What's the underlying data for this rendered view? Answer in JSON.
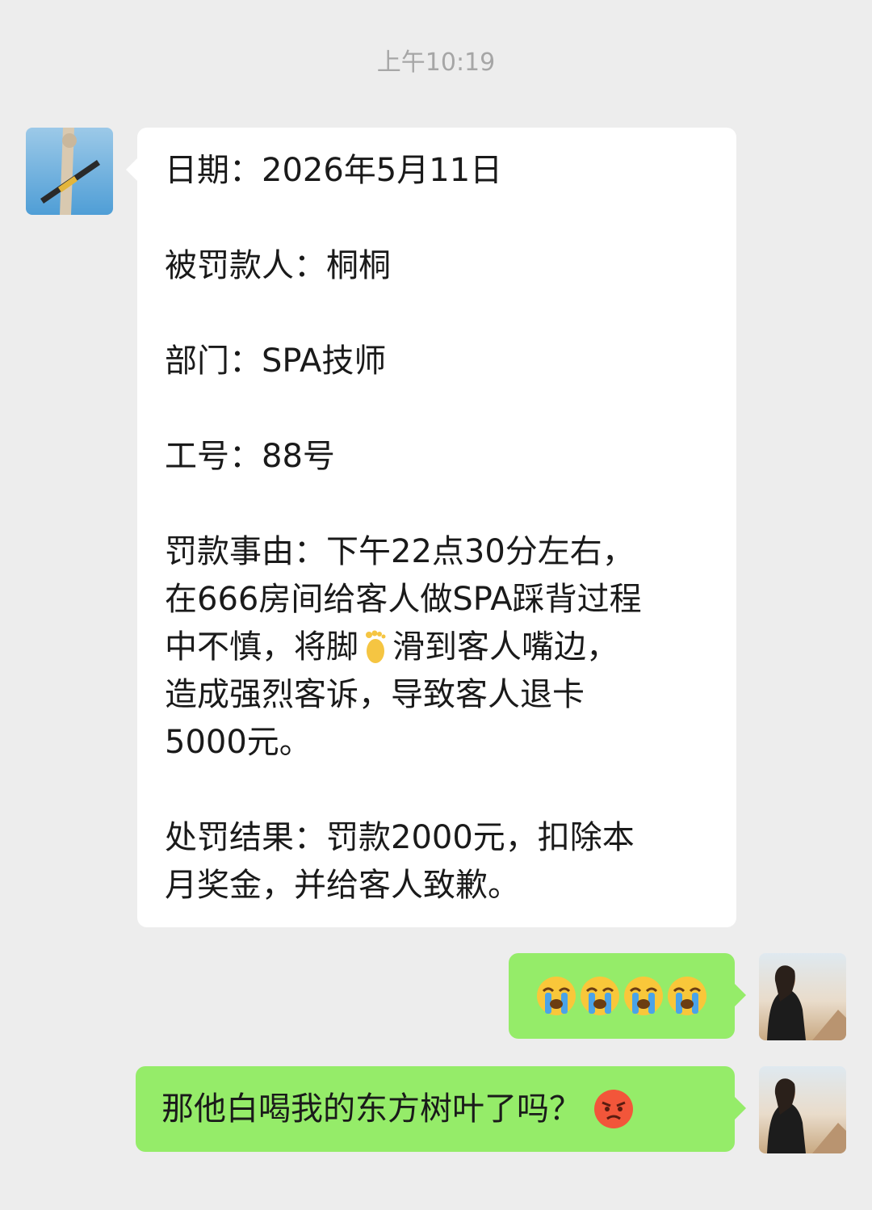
{
  "chat": {
    "timestamp": "上午10:19",
    "incoming_message": {
      "lines": {
        "date": "日期：2026年5月11日",
        "person": "被罚款人：桐桐",
        "department": "部门：SPA技师",
        "employee_no": "工号：88号",
        "reason_1": "罚款事由：下午22点30分左右，",
        "reason_2": "在666房间给客人做SPA踩背过程",
        "reason_3a": "中不慎，将脚",
        "reason_3b": "滑到客人嘴边，",
        "reason_4": "造成强烈客诉，导致客人退卡",
        "reason_5": "5000元。",
        "result_1": "处罚结果：罚款2000元，扣除本",
        "result_2": "月奖金，并给客人致歉。"
      }
    },
    "outgoing_messages": [
      {
        "emoji": "loudly-crying-face",
        "count": 4
      },
      {
        "text": "那他白喝我的东方树叶了吗？",
        "emoji": "pouting-angry-face"
      }
    ],
    "colors": {
      "background": "#ededed",
      "incoming_bubble": "#ffffff",
      "outgoing_bubble": "#95ec69",
      "timestamp": "#a6a6a6"
    }
  }
}
